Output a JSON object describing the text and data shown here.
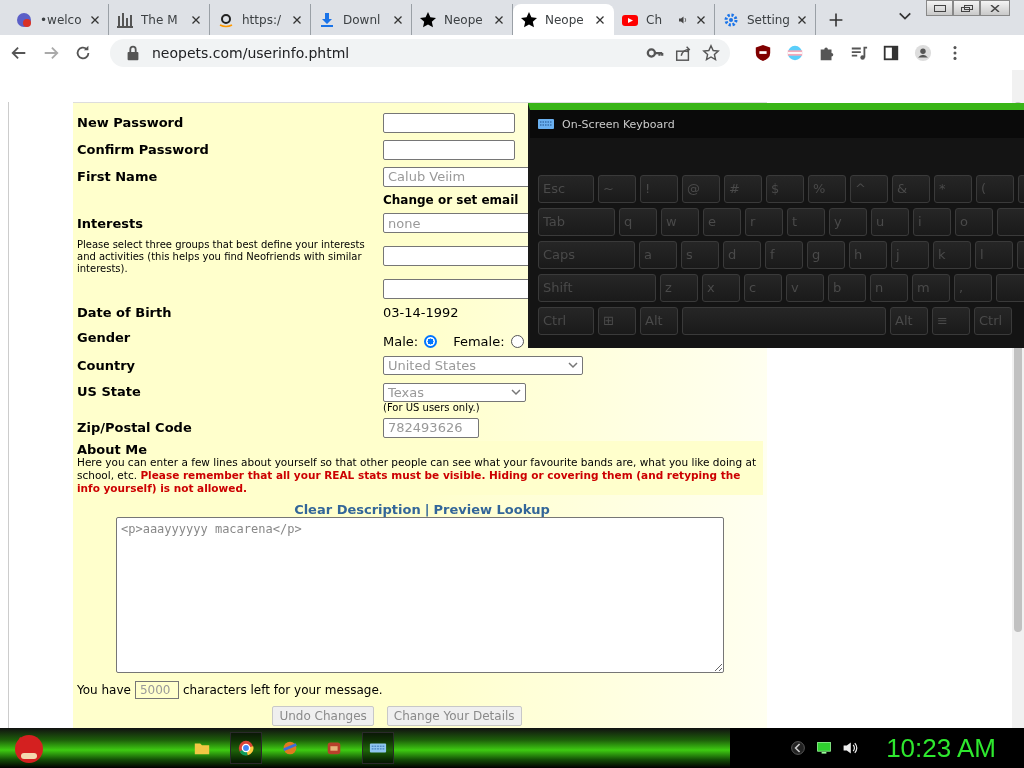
{
  "browser": {
    "tabs": [
      {
        "title": "•welco",
        "selected": false,
        "audio": false
      },
      {
        "title": "The M",
        "selected": false,
        "audio": false
      },
      {
        "title": "https:/",
        "selected": false,
        "audio": false
      },
      {
        "title": "Downl",
        "selected": false,
        "audio": false
      },
      {
        "title": "Neope",
        "selected": false,
        "audio": false
      },
      {
        "title": "Neope",
        "selected": true,
        "audio": false
      },
      {
        "title": "Ch",
        "selected": false,
        "audio": true
      },
      {
        "title": "Setting",
        "selected": false,
        "audio": false
      }
    ],
    "address": "neopets.com/userinfo.phtml"
  },
  "form": {
    "rows": [
      {
        "kind": "input",
        "label": "New Password"
      },
      {
        "kind": "input",
        "label": "Confirm Password"
      },
      {
        "kind": "input",
        "label": "First Name",
        "value": "Calub Veiim"
      },
      {
        "kind": "heading",
        "text": "Change or set email"
      },
      {
        "kind": "interests",
        "label": "Interests",
        "note": "Please select three groups that best define your interests and activities (this helps you find Neofriends with similar interests).",
        "value": "none"
      },
      {
        "kind": "text",
        "label": "Date of Birth",
        "value": "03-14-1992"
      },
      {
        "kind": "radio",
        "label": "Gender",
        "options": [
          {
            "label": "Male:",
            "selected": true
          },
          {
            "label": "Female:",
            "selected": false
          }
        ]
      },
      {
        "kind": "select",
        "label": "Country",
        "value": "United States"
      },
      {
        "kind": "select",
        "label": "US State",
        "value": "Texas",
        "note": "(For US users only.)"
      },
      {
        "kind": "input",
        "label": "Zip/Postal Code",
        "value": "782493626"
      }
    ],
    "about": {
      "title": "About Me",
      "text": "Here you can enter a few lines about yourself so that other people can see what your favourite bands are, what you like doing at school, etc. **Please remember that all your REAL stats must be visible. Hiding or covering them (and retyping the info yourself) is not allowed.**"
    },
    "links": [
      "Clear Description",
      "Preview Lookup"
    ],
    "link_separator": "|",
    "description": "<p>aaayyyyyy macarena</p>",
    "counter": {
      "before": "You have",
      "value": "5000",
      "after": "characters left for your message."
    },
    "buttons": [
      {
        "label": "Undo Changes",
        "disabled": true
      },
      {
        "label": "Change Your Details",
        "disabled": true
      }
    ]
  },
  "keyboard": {
    "title": "On-Screen Keyboard",
    "rows": [
      [
        "Esc",
        "~",
        "!",
        "@",
        "#",
        "$",
        "%",
        "^",
        "&",
        "*",
        "("
      ],
      [
        "Tab",
        "q",
        "w",
        "e",
        "r",
        "t",
        "y",
        "u",
        "i",
        "o"
      ],
      [
        "Caps",
        "a",
        "s",
        "d",
        "f",
        "g",
        "h",
        "j",
        "k",
        "l"
      ],
      [
        "Shift",
        "z",
        "x",
        "c",
        "v",
        "b",
        "n",
        "m",
        ","
      ]
    ],
    "bottom_left": [
      "Ctrl",
      "⊞",
      "Alt"
    ],
    "bottom_right": [
      "Alt",
      "≡",
      "Ctrl"
    ]
  },
  "taskbar": {
    "apps": [
      {
        "selected": false
      },
      {
        "selected": true
      },
      {
        "selected": false
      },
      {
        "selected": false
      },
      {
        "selected": true
      }
    ],
    "clock": "10:23 AM"
  }
}
